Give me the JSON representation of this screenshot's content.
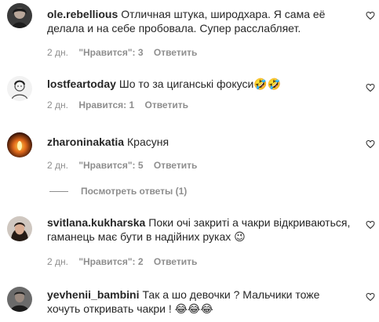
{
  "comments": [
    {
      "username": "ole.rebellious",
      "text": "Отличная штука, широдхара. Я сама её делала и на себе пробовала. Супер расслабляет.",
      "time": "2 дн.",
      "likes": "\"Нравится\": 3",
      "reply": "Ответить",
      "avatar": "avatar-dark-woman"
    },
    {
      "username": "lostfeartoday",
      "text": "Шо то за циганські фокуси🤣🤣",
      "time": "2 дн.",
      "likes": "Нравится: 1",
      "reply": "Ответить",
      "avatar": "avatar-sketch-man"
    },
    {
      "username": "zharoninakatia",
      "text": "Красуня",
      "time": "2 дн.",
      "likes": "\"Нравится\": 5",
      "reply": "Ответить",
      "avatar": "avatar-candle-orange",
      "view_replies": "Посмотреть ответы (1)"
    },
    {
      "username": "svitlana.kukharska",
      "text": "Поки очі закриті а чакри відкриваються, гаманець має бути в надійних руках 😉",
      "time": "2 дн.",
      "likes": "\"Нравится\": 2",
      "reply": "Ответить",
      "avatar": "avatar-woman-dark-hair"
    },
    {
      "username": "yevhenii_bambini",
      "text": "Так а шо девочки ? Мальчики тоже хочуть откривать чакри ! 😂😂😂",
      "avatar": "avatar-man-dark"
    }
  ],
  "colors": {
    "text": "#262626",
    "secondary": "#8e8e8e",
    "background": "#ffffff"
  },
  "icons": {
    "like": "heart-outline-icon"
  }
}
